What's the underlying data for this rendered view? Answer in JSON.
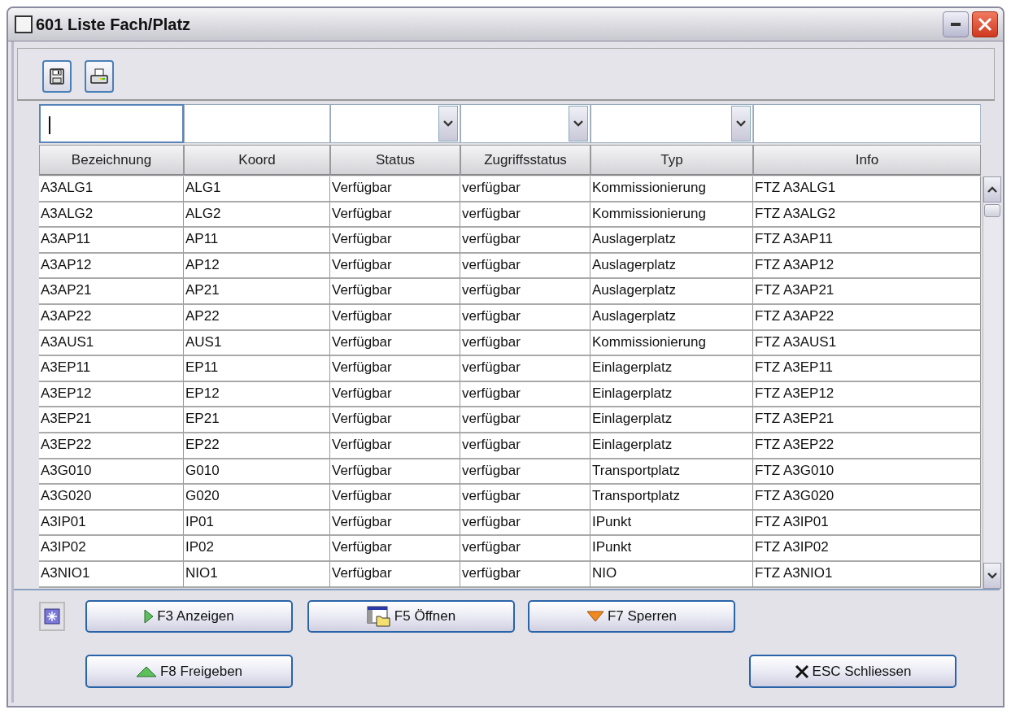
{
  "window": {
    "title": "601 Liste Fach/Platz"
  },
  "toolbar": {
    "buttons": [
      {
        "kind": "save"
      },
      {
        "kind": "print"
      }
    ]
  },
  "filters": [
    {
      "kind": "text",
      "focused": true
    },
    {
      "kind": "text",
      "focused": false
    },
    {
      "kind": "select",
      "focused": false
    },
    {
      "kind": "select",
      "focused": false
    },
    {
      "kind": "select",
      "focused": false
    },
    {
      "kind": "text",
      "focused": false
    }
  ],
  "table": {
    "columns": [
      "Bezeichnung",
      "Koord",
      "Status",
      "Zugriffsstatus",
      "Typ",
      "Info"
    ],
    "rows": [
      [
        "A3ALG1",
        "ALG1",
        "Verfügbar",
        "verfügbar",
        "Kommissionierung",
        "FTZ A3ALG1"
      ],
      [
        "A3ALG2",
        "ALG2",
        "Verfügbar",
        "verfügbar",
        "Kommissionierung",
        "FTZ A3ALG2"
      ],
      [
        "A3AP11",
        "AP11",
        "Verfügbar",
        "verfügbar",
        "Auslagerplatz",
        "FTZ A3AP11"
      ],
      [
        "A3AP12",
        "AP12",
        "Verfügbar",
        "verfügbar",
        "Auslagerplatz",
        "FTZ A3AP12"
      ],
      [
        "A3AP21",
        "AP21",
        "Verfügbar",
        "verfügbar",
        "Auslagerplatz",
        "FTZ A3AP21"
      ],
      [
        "A3AP22",
        "AP22",
        "Verfügbar",
        "verfügbar",
        "Auslagerplatz",
        "FTZ A3AP22"
      ],
      [
        "A3AUS1",
        "AUS1",
        "Verfügbar",
        "verfügbar",
        "Kommissionierung",
        "FTZ A3AUS1"
      ],
      [
        "A3EP11",
        "EP11",
        "Verfügbar",
        "verfügbar",
        "Einlagerplatz",
        "FTZ A3EP11"
      ],
      [
        "A3EP12",
        "EP12",
        "Verfügbar",
        "verfügbar",
        "Einlagerplatz",
        "FTZ A3EP12"
      ],
      [
        "A3EP21",
        "EP21",
        "Verfügbar",
        "verfügbar",
        "Einlagerplatz",
        "FTZ A3EP21"
      ],
      [
        "A3EP22",
        "EP22",
        "Verfügbar",
        "verfügbar",
        "Einlagerplatz",
        "FTZ A3EP22"
      ],
      [
        "A3G010",
        "G010",
        "Verfügbar",
        "verfügbar",
        "Transportplatz",
        "FTZ A3G010"
      ],
      [
        "A3G020",
        "G020",
        "Verfügbar",
        "verfügbar",
        "Transportplatz",
        "FTZ A3G020"
      ],
      [
        "A3IP01",
        "IP01",
        "Verfügbar",
        "verfügbar",
        "IPunkt",
        "FTZ A3IP01"
      ],
      [
        "A3IP02",
        "IP02",
        "Verfügbar",
        "verfügbar",
        "IPunkt",
        "FTZ A3IP02"
      ],
      [
        "A3NIO1",
        "NIO1",
        "Verfügbar",
        "verfügbar",
        "NIO",
        "FTZ A3NIO1"
      ]
    ]
  },
  "actions": [
    {
      "kind": "star"
    },
    {
      "kind": "play",
      "label": "F3 Anzeigen"
    },
    {
      "kind": "open",
      "label": "F5 Öffnen"
    },
    {
      "kind": "lock",
      "label": "F7 Sperren"
    },
    {
      "kind": "release",
      "label": "F8 Freigeben"
    },
    {
      "kind": "close",
      "label": "ESC Schliessen"
    }
  ]
}
